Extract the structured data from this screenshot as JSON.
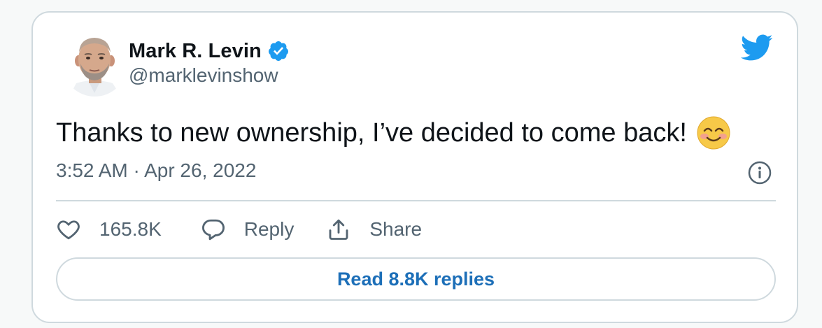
{
  "author": {
    "name": "Mark R. Levin",
    "handle": "@marklevinshow",
    "verified": true,
    "avatar_icon": "profile-photo"
  },
  "tweet": {
    "text": "Thanks to new ownership, I’ve decided to come back!",
    "emoji_icon": "smiling-face-with-smiling-eyes",
    "timestamp": "3:52 AM · Apr 26, 2022"
  },
  "actions": {
    "like_count": "165.8K",
    "reply_label": "Reply",
    "share_label": "Share"
  },
  "footer": {
    "read_replies_label": "Read 8.8K replies"
  },
  "colors": {
    "brand_blue": "#1d9bf0",
    "link_blue": "#1d6fb8",
    "text_primary": "#0f1419",
    "text_secondary": "#536471",
    "border": "#cfd9de"
  },
  "icons": {
    "brand": "twitter-bird-icon",
    "info": "info-icon",
    "like": "heart-icon",
    "reply": "speech-bubble-icon",
    "share": "share-upload-icon"
  }
}
